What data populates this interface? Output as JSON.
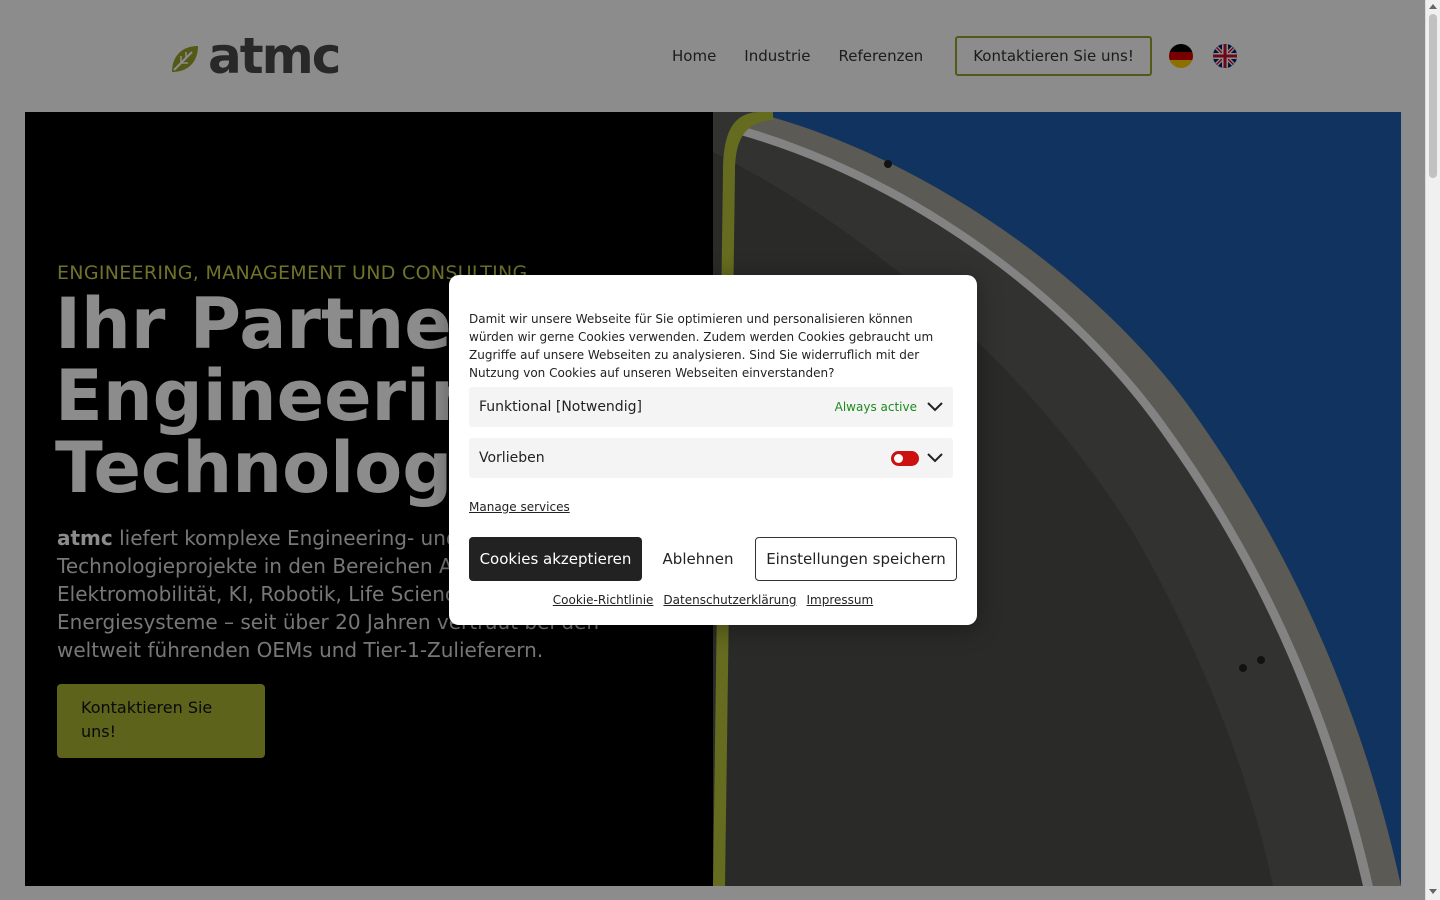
{
  "header": {
    "logo_text": "atmc",
    "nav": [
      "Home",
      "Industrie",
      "Referenzen"
    ],
    "cta_label": "Kontaktieren Sie uns!",
    "languages": [
      "de-flag-icon",
      "uk-flag-icon"
    ]
  },
  "hero": {
    "kicker": "ENGINEERING, MANAGEMENT UND CONSULTING",
    "headline_line1": "Ihr Partner",
    "headline_line2": "Engineering",
    "headline_line3": "Technologie",
    "lead_brand": "atmc",
    "lead_text": " liefert komplexe Engineering- und Technologieprojekte in den Bereichen Automotive, Elektromobilität, KI, Robotik, Life Sciences und Energiesysteme – seit über 20 Jahren vertraut bei den weltweit führenden OEMs und Tier-1-Zulieferern.",
    "button_label": "Kontaktieren Sie uns!"
  },
  "cookie": {
    "text": "Damit wir unsere Webseite für Sie optimieren und personalisieren können würden wir gerne Cookies verwenden. Zudem werden Cookies gebraucht um Zugriffe auf unsere Webseiten zu analysieren. Sind Sie widerruflich mit der Nutzung von Cookies auf unseren Webseiten einverstanden?",
    "section_functional": "Funktional [Notwendig]",
    "functional_status": "Always active",
    "section_preferences": "Vorlieben",
    "manage_services": "Manage services",
    "accept_label": "Cookies akzeptieren",
    "deny_label": "Ablehnen",
    "save_label": "Einstellungen speichern",
    "links": [
      "Cookie-Richtlinie",
      "Datenschutzerklärung",
      "Impressum"
    ]
  },
  "colors": {
    "accent": "#a9b531",
    "accept_button": "#222222",
    "toggle_off": "#cc1111",
    "always_active": "#1d8a1d"
  }
}
